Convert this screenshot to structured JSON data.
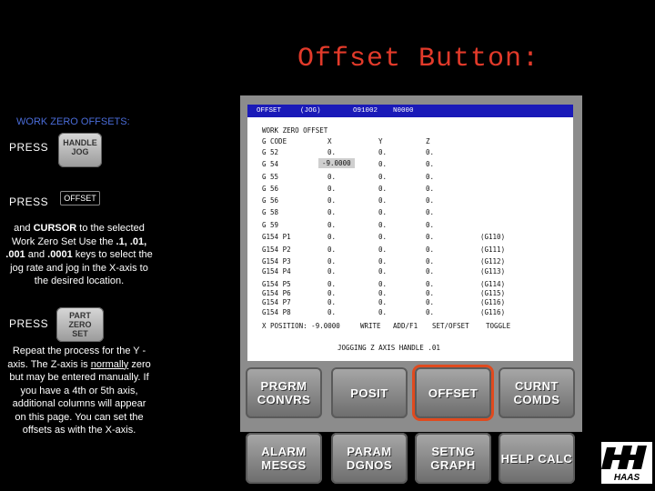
{
  "title": "Offset Button:",
  "left": {
    "wz_title": "WORK ZERO OFFSETS:",
    "press1": "PRESS",
    "key_handle_jog": "HANDLE JOG",
    "press2": "PRESS",
    "key_offset": "OFFSET",
    "para1_a": "and ",
    "para1_b": "CURSOR",
    "para1_c": " to the selected Work Zero Set Use the ",
    "para1_d": ".1, .01, .001",
    "para1_e": " and ",
    "para1_f": ".0001",
    "para1_g": " keys to select the jog rate and jog in the X-axis to the desired location.",
    "press3": "PRESS",
    "key_part_zero_set": "PART ZERO SET",
    "para2_a": "Repeat the process for the Y -axis. The Z-axis is ",
    "para2_u": "normally",
    "para2_b": " zero but may be entered manually. If you have a 4th or 5th axis, additional columns will appear on this page. You can set the offsets as with the X-axis."
  },
  "screen": {
    "head": [
      "OFFSET",
      "(JOG)",
      "O91002",
      "N0000"
    ],
    "section": "WORK ZERO OFFSET",
    "col_headers": [
      "G CODE",
      "X",
      "Y",
      "Z"
    ],
    "rows": [
      {
        "code": "G 52",
        "x": "0.",
        "y": "0.",
        "z": "0.",
        "note": ""
      },
      {
        "code": "G 54",
        "x": "-9.0000",
        "y": "0.",
        "z": "0.",
        "note": ""
      },
      {
        "code": "G 55",
        "x": "0.",
        "y": "0.",
        "z": "0.",
        "note": ""
      },
      {
        "code": "G 56",
        "x": "0.",
        "y": "0.",
        "z": "0.",
        "note": ""
      },
      {
        "code": "G 56",
        "x": "0.",
        "y": "0.",
        "z": "0.",
        "note": ""
      },
      {
        "code": "G 58",
        "x": "0.",
        "y": "0.",
        "z": "0.",
        "note": ""
      },
      {
        "code": "G 59",
        "x": "0.",
        "y": "0.",
        "z": "0.",
        "note": ""
      },
      {
        "code": "G154 P1",
        "x": "0.",
        "y": "0.",
        "z": "0.",
        "note": "(G110)"
      },
      {
        "code": "G154 P2",
        "x": "0.",
        "y": "0.",
        "z": "0.",
        "note": "(G111)"
      },
      {
        "code": "G154 P3",
        "x": "0.",
        "y": "0.",
        "z": "0.",
        "note": "(G112)"
      },
      {
        "code": "G154 P4",
        "x": "0.",
        "y": "0.",
        "z": "0.",
        "note": "(G113)"
      },
      {
        "code": "G154 P5",
        "x": "0.",
        "y": "0.",
        "z": "0.",
        "note": "(G114)"
      },
      {
        "code": "G154 P6",
        "x": "0.",
        "y": "0.",
        "z": "0.",
        "note": "(G115)"
      },
      {
        "code": "G154 P7",
        "x": "0.",
        "y": "0.",
        "z": "0.",
        "note": "(G116)"
      },
      {
        "code": "G154 P8",
        "x": "0.",
        "y": "0.",
        "z": "0.",
        "note": "(G116)"
      }
    ],
    "footer": [
      "X POSITION: -9.0000",
      "WRITE",
      "ADD/F1",
      "SET/OFSET",
      "TOGGLE"
    ],
    "status": "JOGGING Z AXIS HANDLE .01"
  },
  "buttons": [
    {
      "label": "PRGRM CONVRS"
    },
    {
      "label": "POSIT"
    },
    {
      "label": "OFFSET"
    },
    {
      "label": "CURNT COMDS"
    },
    {
      "label": "ALARM MESGS"
    },
    {
      "label": "PARAM DGNOS"
    },
    {
      "label": "SETNG GRAPH"
    },
    {
      "label": "HELP CALC"
    }
  ],
  "logo_text": "HAAS",
  "colors": {
    "title": "#e23a2a",
    "wz_title": "#4a6cd8",
    "highlight": "#e04a1e",
    "screen_header": "#1a1ab8"
  }
}
